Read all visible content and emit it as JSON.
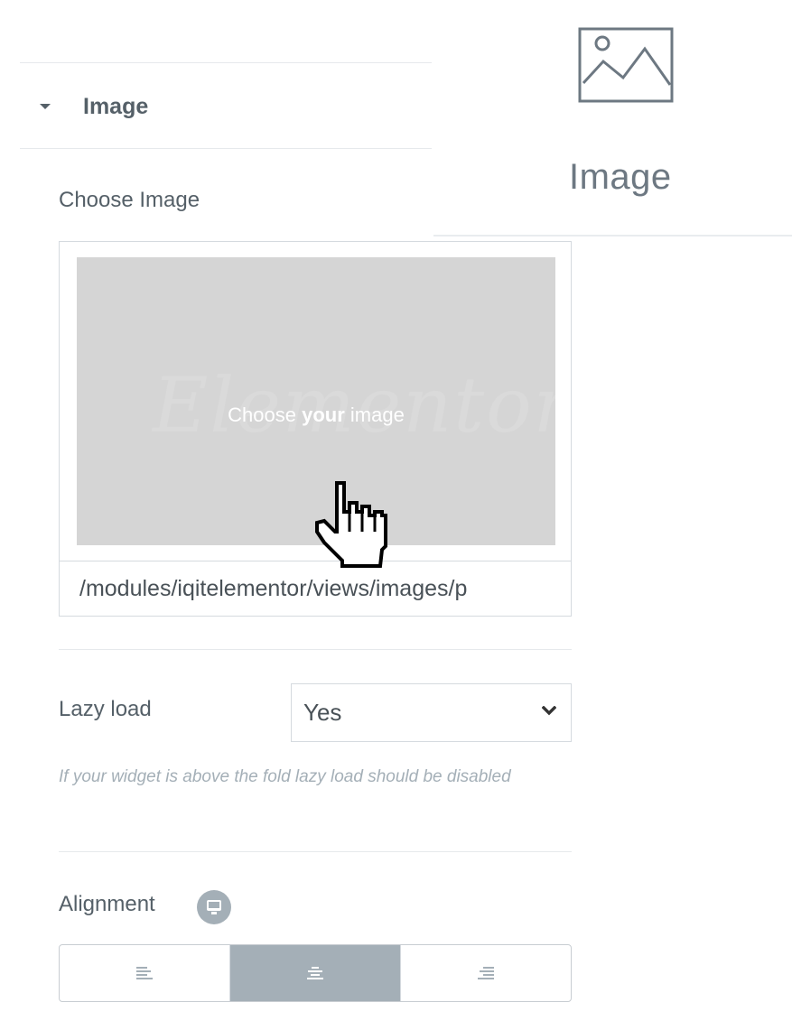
{
  "widget_panel": {
    "label": "Image",
    "icon": "image-icon"
  },
  "section": {
    "title": "Image",
    "icon": "caret-down-icon"
  },
  "choose_image": {
    "label": "Choose Image",
    "placeholder_watermark": "Elementor",
    "prompt_before": "Choose ",
    "prompt_bold": "your",
    "prompt_after": " image",
    "url": "/modules/iqitelementor/views/images/p"
  },
  "lazy_load": {
    "label": "Lazy load",
    "value": "Yes",
    "description": "If your widget is above the fold lazy load should be disabled",
    "icon": "chevron-down-icon"
  },
  "alignment": {
    "label": "Alignment",
    "responsive_icon": "desktop-icon",
    "options": [
      {
        "icon": "align-left-icon"
      },
      {
        "icon": "align-center-icon"
      },
      {
        "icon": "align-right-icon"
      }
    ],
    "selected_index": 1
  },
  "cursor": "hand-pointer-icon",
  "colors": {
    "label_text": "#556068",
    "border": "#d5dadf",
    "placeholder_bg": "#d5d5d5",
    "active_choice": "#a4afb7",
    "description_text": "#a4afb7"
  }
}
